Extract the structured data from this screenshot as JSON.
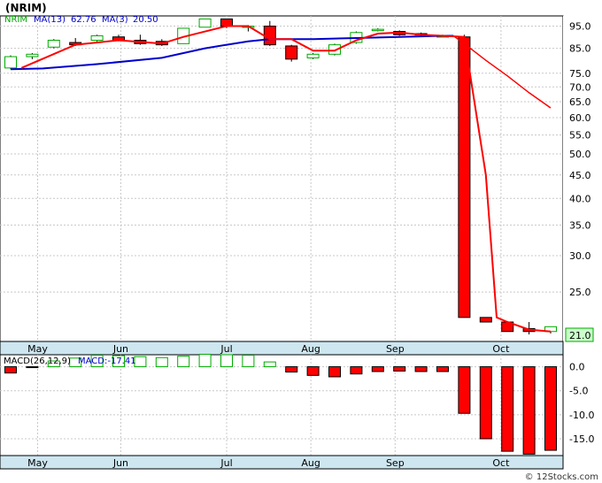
{
  "title": "(NRIM)",
  "legend": {
    "ticker": "NRIM",
    "ma_long_label": "MA(13)",
    "ma_long_value": "62.76",
    "ma_short_label": "MA(3)",
    "ma_short_value": "20.50"
  },
  "macd_legend": {
    "label": "MACD(26,12,9)",
    "value_label": "MACD:-17.41"
  },
  "last_price_badge": "21.0",
  "footer": "© 12Stocks.com",
  "colors": {
    "up": "#00aa00",
    "down": "#ff0000",
    "ma_long": "#0000cc",
    "ma_short": "#ff0000",
    "axis_band": "#cde6f0",
    "grid": "#c8c8c8"
  },
  "chart_data": [
    {
      "type": "candlestick",
      "scale": "log",
      "ylim": [
        19.5,
        100
      ],
      "y_ticks": [
        95,
        85,
        75,
        70,
        65,
        60,
        55,
        50,
        45,
        40,
        35,
        30,
        25
      ],
      "x_labels": [
        "May",
        "Jun",
        "Jul",
        "Aug",
        "Sep",
        "Oct"
      ],
      "x_label_positions": [
        1.25,
        5.1,
        10.0,
        13.9,
        17.8,
        22.7
      ],
      "candles": [
        {
          "o": 77.0,
          "h": 82.0,
          "l": 76.5,
          "c": 81.5
        },
        {
          "o": 81.5,
          "h": 83.0,
          "l": 80.5,
          "c": 82.5
        },
        {
          "o": 85.5,
          "h": 89.0,
          "l": 85.0,
          "c": 88.5
        },
        {
          "o": 87.5,
          "h": 89.5,
          "l": 86.0,
          "c": 86.5
        },
        {
          "o": 88.5,
          "h": 91.0,
          "l": 88.0,
          "c": 90.5
        },
        {
          "o": 90.0,
          "h": 91.0,
          "l": 88.0,
          "c": 88.5
        },
        {
          "o": 88.5,
          "h": 91.0,
          "l": 86.5,
          "c": 87.0
        },
        {
          "o": 88.0,
          "h": 89.0,
          "l": 86.0,
          "c": 86.5
        },
        {
          "o": 87.0,
          "h": 94.0,
          "l": 87.0,
          "c": 94.0
        },
        {
          "o": 94.5,
          "h": 98.5,
          "l": 94.5,
          "c": 98.5
        },
        {
          "o": 98.5,
          "h": 98.5,
          "l": 94.0,
          "c": 95.0
        },
        {
          "o": 94.5,
          "h": 95.5,
          "l": 92.5,
          "c": 95.0
        },
        {
          "o": 95.0,
          "h": 97.5,
          "l": 86.0,
          "c": 86.5
        },
        {
          "o": 86.0,
          "h": 86.5,
          "l": 79.5,
          "c": 80.5
        },
        {
          "o": 81.0,
          "h": 83.0,
          "l": 80.5,
          "c": 82.5
        },
        {
          "o": 82.5,
          "h": 87.0,
          "l": 82.0,
          "c": 86.5
        },
        {
          "o": 87.5,
          "h": 92.5,
          "l": 87.0,
          "c": 92.0
        },
        {
          "o": 93.0,
          "h": 94.0,
          "l": 92.5,
          "c": 93.5
        },
        {
          "o": 92.5,
          "h": 93.0,
          "l": 90.5,
          "c": 91.0
        },
        {
          "o": 91.5,
          "h": 92.0,
          "l": 90.5,
          "c": 91.0
        },
        {
          "o": 90.5,
          "h": 91.0,
          "l": 90.0,
          "c": 90.5
        },
        {
          "o": 90.0,
          "h": 91.0,
          "l": 22.0,
          "c": 22.0
        },
        {
          "o": 22.0,
          "h": 22.0,
          "l": 21.5,
          "c": 21.5
        },
        {
          "o": 21.5,
          "h": 21.5,
          "l": 20.5,
          "c": 20.5
        },
        {
          "o": 20.8,
          "h": 21.5,
          "l": 20.2,
          "c": 20.5
        },
        {
          "o": 20.5,
          "h": 21.0,
          "l": 20.3,
          "c": 21.0
        }
      ],
      "ma13": [
        [
          0,
          76.5
        ],
        [
          1.5,
          76.8
        ],
        [
          4,
          78.5
        ],
        [
          7,
          81.0
        ],
        [
          9,
          85.0
        ],
        [
          10,
          86.5
        ],
        [
          11,
          88.0
        ],
        [
          12,
          89.0
        ],
        [
          14,
          89.0
        ],
        [
          16,
          89.5
        ],
        [
          18,
          90.0
        ],
        [
          20,
          90.5
        ],
        [
          20.5,
          90.5
        ]
      ],
      "ma3": [
        [
          0.5,
          77.0
        ],
        [
          3,
          86.5
        ],
        [
          5,
          88.5
        ],
        [
          7,
          87.0
        ],
        [
          8,
          90.0
        ],
        [
          10,
          95.0
        ],
        [
          11,
          95.0
        ],
        [
          12,
          89.0
        ],
        [
          13,
          89.0
        ],
        [
          14,
          84.0
        ],
        [
          15,
          84.0
        ],
        [
          16,
          88.5
        ],
        [
          17,
          91.5
        ],
        [
          18,
          92.0
        ],
        [
          19,
          91.0
        ],
        [
          20,
          90.5
        ],
        [
          21,
          90.0
        ],
        [
          22,
          45.0
        ],
        [
          22.5,
          22.0
        ],
        [
          23,
          21.5
        ],
        [
          24,
          20.7
        ],
        [
          25,
          20.5
        ]
      ],
      "ma3_extension": [
        [
          20.5,
          90.5
        ],
        [
          21,
          87.0
        ],
        [
          22,
          80.0
        ],
        [
          23,
          74.0
        ],
        [
          24,
          68.0
        ],
        [
          25,
          63.0
        ]
      ]
    },
    {
      "type": "bar",
      "title": "MACD(26,12,9)",
      "ylim": [
        -18.5,
        2.5
      ],
      "y_ticks": [
        0.0,
        -5.0,
        -10.0,
        -15.0
      ],
      "x_labels": [
        "May",
        "Jun",
        "Jul",
        "Aug",
        "Sep",
        "Oct"
      ],
      "values": [
        -1.3,
        -0.1,
        1.2,
        1.8,
        2.4,
        2.3,
        2.1,
        1.9,
        2.2,
        2.6,
        2.5,
        2.4,
        1.0,
        -1.1,
        -1.8,
        -2.1,
        -1.5,
        -1.0,
        -0.9,
        -1.0,
        -1.0,
        -9.7,
        -15.0,
        -17.6,
        -18.2,
        -17.4
      ]
    }
  ]
}
